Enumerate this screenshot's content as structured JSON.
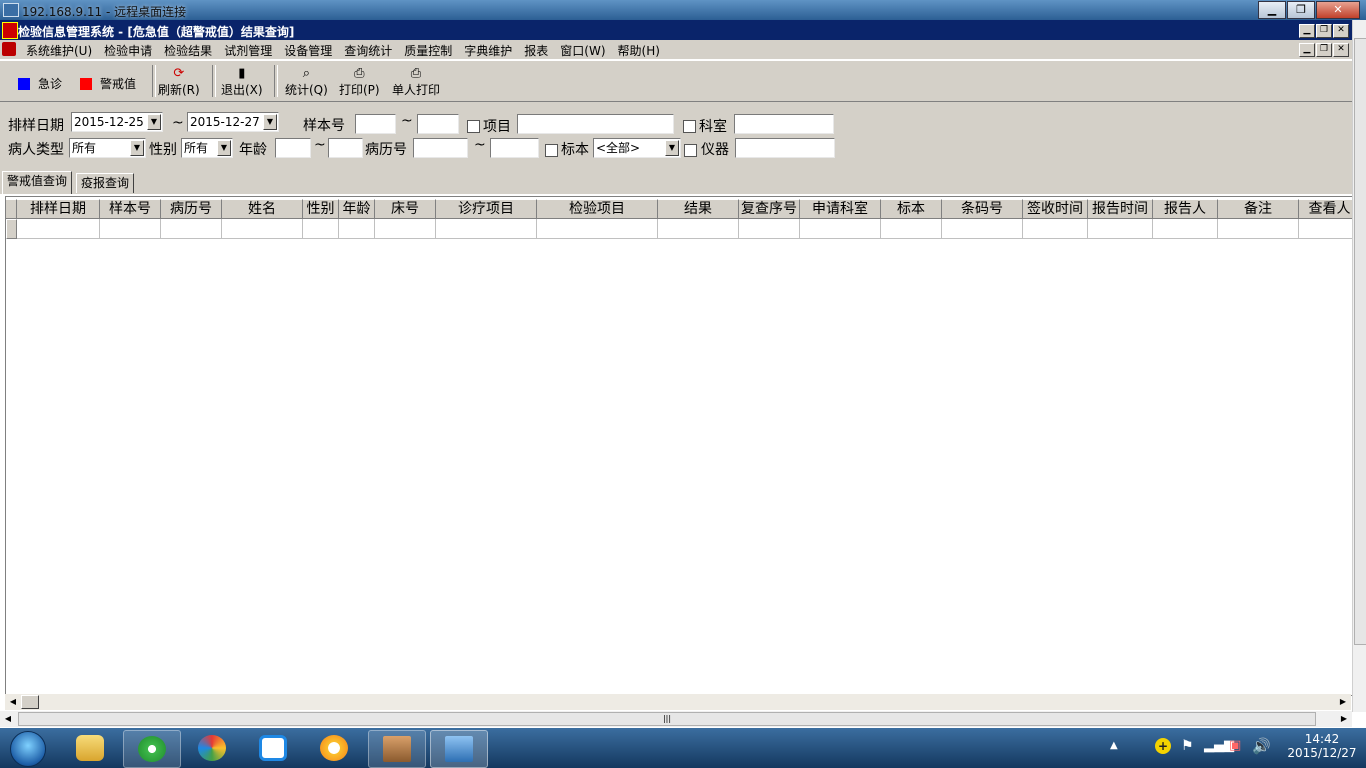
{
  "remote": {
    "title": "192.168.9.11 - 远程桌面连接",
    "min": "▁",
    "restore": "❐",
    "close": "✕"
  },
  "app": {
    "title": "检验信息管理系统 - [危急值（超警戒值）结果查询]",
    "min": "▁",
    "restore": "❐",
    "close": "✕"
  },
  "menu": [
    "系统维护(U)",
    "检验申请",
    "检验结果",
    "试剂管理",
    "设备管理",
    "查询统计",
    "质量控制",
    "字典维护",
    "报表",
    "窗口(W)",
    "帮助(H)"
  ],
  "legend": {
    "urgent": "急诊",
    "urgent_color": "#0000ff",
    "alert": "警戒值",
    "alert_color": "#ff0000"
  },
  "toolbar": {
    "refresh": "刷新(R)",
    "exit": "退出(X)",
    "stats": "统计(Q)",
    "print": "打印(P)",
    "print_single": "单人打印"
  },
  "filters": {
    "date_label": "排样日期",
    "date_from": "2015-12-25",
    "date_to": "2015-12-27",
    "tilde": "~",
    "sample_no_label": "样本号",
    "project_label": "项目",
    "dept_label": "科室",
    "patient_type_label": "病人类型",
    "patient_type": "所有",
    "gender_label": "性别",
    "gender": "所有",
    "age_label": "年龄",
    "record_no_label": "病历号",
    "specimen_label": "标本",
    "specimen": "<全部>",
    "instrument_label": "仪器"
  },
  "tabs": [
    "警戒值查询",
    "疫报查询"
  ],
  "columns": [
    "排样日期",
    "样本号",
    "病历号",
    "姓名",
    "性别",
    "年龄",
    "床号",
    "诊疗项目",
    "检验项目",
    "结果",
    "复查序号",
    "申请科室",
    "标本",
    "条码号",
    "签收时间",
    "报告时间",
    "报告人",
    "备注",
    "查看人"
  ],
  "scroll": {
    "grip": "|||"
  },
  "clock": {
    "time": "14:42",
    "date": "2015/12/27"
  }
}
